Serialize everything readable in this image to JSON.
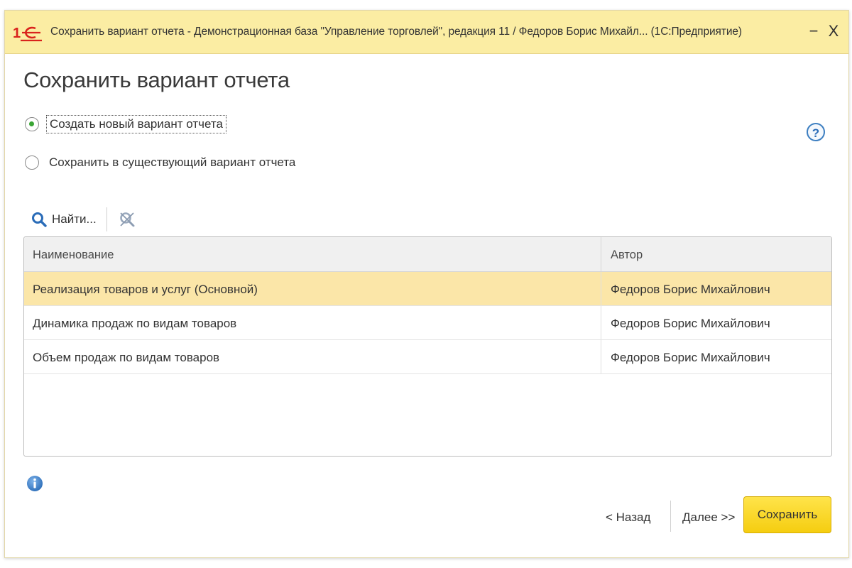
{
  "window": {
    "title": "Сохранить вариант отчета - Демонстрационная база \"Управление торговлей\", редакция 11 / Федоров Борис Михайл...  (1С:Предприятие)",
    "minimize_label": "−",
    "close_label": "X"
  },
  "page": {
    "title": "Сохранить вариант отчета",
    "help_label": "?"
  },
  "options": {
    "selected": "create_new",
    "create_new_label": "Создать новый вариант отчета",
    "save_existing_label": "Сохранить в существующий вариант отчета"
  },
  "toolbar": {
    "find_label": "Найти..."
  },
  "table": {
    "columns": [
      "Наименование",
      "Автор"
    ],
    "rows": [
      {
        "name": "Реализация товаров и услуг (Основной)",
        "author": "Федоров Борис Михайлович",
        "selected": true
      },
      {
        "name": "Динамика продаж по видам товаров",
        "author": "Федоров Борис Михайлович",
        "selected": false
      },
      {
        "name": "Объем продаж по видам товаров",
        "author": "Федоров Борис Михайлович",
        "selected": false
      }
    ]
  },
  "footer": {
    "back_label": "< Назад",
    "next_label": "Далее >>",
    "save_label": "Сохранить"
  },
  "colors": {
    "titlebar_bg": "#fbeda3",
    "selected_row": "#fbe6a8",
    "save_button": "#f5cd10",
    "logo_red": "#d9231c",
    "radio_dot": "#3aa535",
    "icon_blue": "#2a6cb8"
  }
}
